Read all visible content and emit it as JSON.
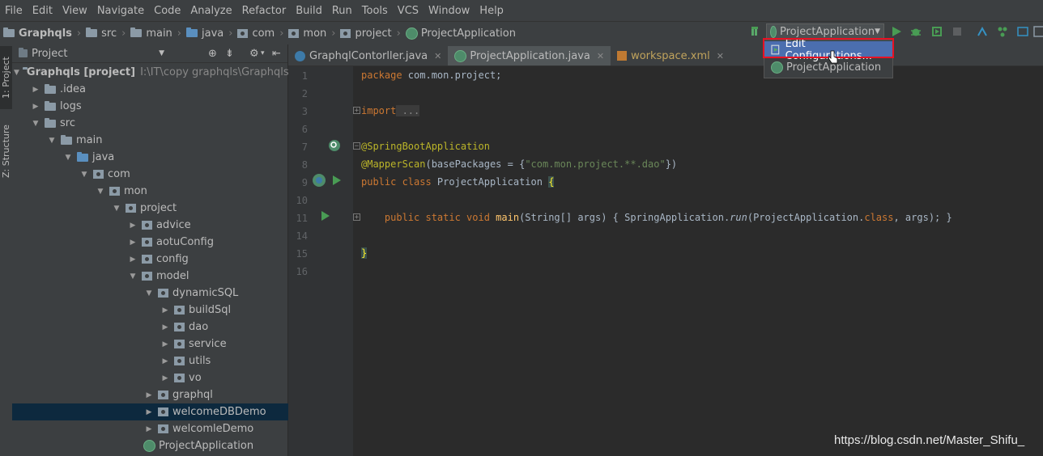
{
  "menu": [
    "File",
    "Edit",
    "View",
    "Navigate",
    "Code",
    "Analyze",
    "Refactor",
    "Build",
    "Run",
    "Tools",
    "VCS",
    "Window",
    "Help"
  ],
  "breadcrumb": [
    "Graphqls",
    "src",
    "main",
    "java",
    "com",
    "mon",
    "project",
    "ProjectApplication"
  ],
  "run_config": {
    "selected": "ProjectApplication"
  },
  "popup": {
    "items": [
      "Edit Configurations...",
      "ProjectApplication"
    ]
  },
  "side_tabs": {
    "project": "1: Project",
    "structure": "Z: Structure"
  },
  "project_panel": {
    "title": "Project"
  },
  "tree": [
    {
      "label": "Graphqls [project]",
      "extra": "I:\\IT\\copy graphqls\\Graphqls",
      "expanded": true
    },
    {
      "label": ".idea"
    },
    {
      "label": "logs"
    },
    {
      "label": "src"
    },
    {
      "label": "main"
    },
    {
      "label": "java"
    },
    {
      "label": "com"
    },
    {
      "label": "mon"
    },
    {
      "label": "project"
    },
    {
      "label": "advice"
    },
    {
      "label": "aotuConfig"
    },
    {
      "label": "config"
    },
    {
      "label": "model"
    },
    {
      "label": "dynamicSQL"
    },
    {
      "label": "buildSql"
    },
    {
      "label": "dao"
    },
    {
      "label": "service"
    },
    {
      "label": "utils"
    },
    {
      "label": "vo"
    },
    {
      "label": "graphql"
    },
    {
      "label": "welcomeDBDemo"
    },
    {
      "label": "welcomleDemo"
    },
    {
      "label": "ProjectApplication"
    }
  ],
  "editor_tabs": [
    "GraphqlContorller.java",
    "ProjectApplication.java",
    "workspace.xml"
  ],
  "line_numbers": [
    "1",
    "2",
    "3",
    "6",
    "7",
    "8",
    "9",
    "10",
    "11",
    "14",
    "15",
    "16"
  ],
  "code": {
    "l1a": "package",
    "l1b": " com.mon.project;",
    "l3a": "import",
    "l3b": " ...",
    "l7": "@SpringBootApplication",
    "l8a": "@MapperScan",
    "l8b": "(basePackages = {",
    "l8c": "\"com.mon.project.**.dao\"",
    "l8d": "})",
    "l9a": "public class",
    "l9b": " ProjectApplication ",
    "l9c": "{",
    "l11a": "    public static void ",
    "l11b": "main",
    "l11c": "(String[] args) { SpringApplication.",
    "l11d": "run",
    "l11e": "(ProjectApplication.",
    "l11f": "class",
    "l11g": ", args); }",
    "l15": "}"
  },
  "watermark": "https://blog.csdn.net/Master_Shifu_"
}
